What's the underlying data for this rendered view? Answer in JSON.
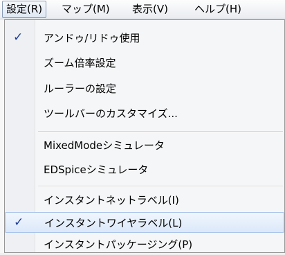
{
  "menubar": {
    "items": [
      {
        "label": "設定(R)"
      },
      {
        "label": "マップ(M)"
      },
      {
        "label": "表示(V)"
      },
      {
        "label": "ヘルプ(H)"
      }
    ]
  },
  "settings_menu": {
    "items": [
      {
        "label": "アンドゥ/リドゥ使用",
        "checked": true
      },
      {
        "label": "ズーム倍率設定"
      },
      {
        "label": "ルーラーの設定"
      },
      {
        "label": "ツールバーのカスタマイズ..."
      },
      {
        "label": "MixedModeシミュレータ"
      },
      {
        "label": "EDSpiceシミュレータ"
      },
      {
        "label": "インスタントネットラベル(I)"
      },
      {
        "label": "インスタントワイヤラベル(L)",
        "checked": true
      },
      {
        "label": "インスタントパッケージング(P)"
      }
    ],
    "check_glyph": "✓"
  }
}
